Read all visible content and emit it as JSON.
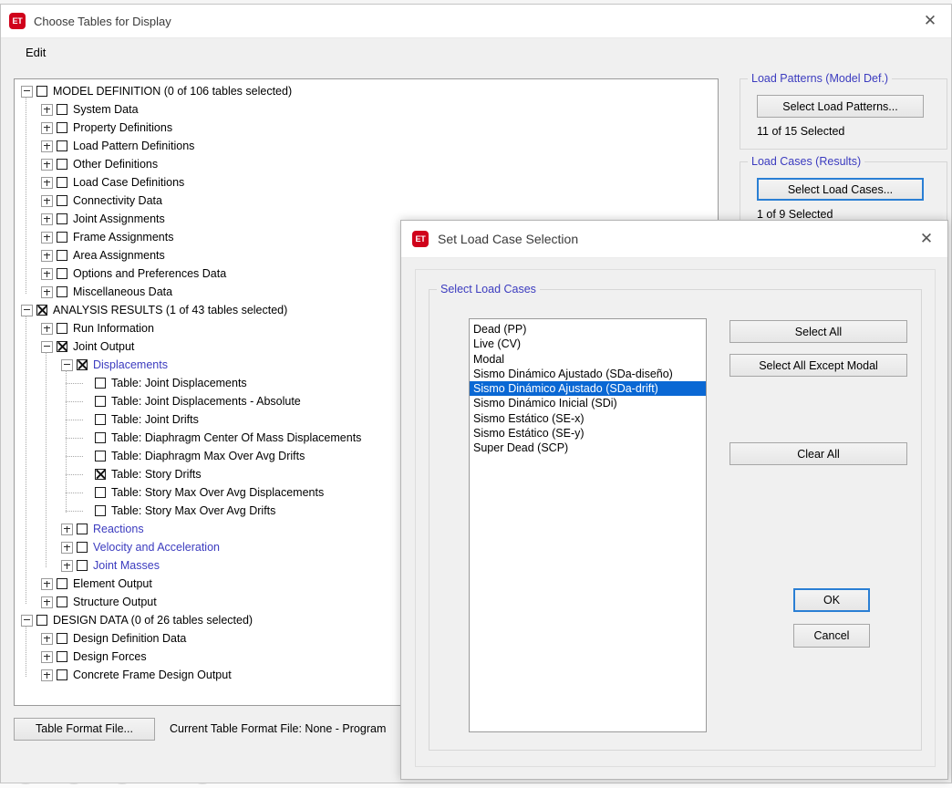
{
  "desktop": {
    "background_circles": [
      "2",
      "0",
      "3",
      "4"
    ]
  },
  "main_window": {
    "icon": "etabs-icon",
    "icon_text": "ET",
    "title": "Choose Tables for Display",
    "close_label": "✕",
    "menu": {
      "edit": "Edit"
    },
    "tree": [
      {
        "level": 0,
        "toggle": "minus",
        "check": "unchecked",
        "label": "MODEL DEFINITION  (0 of 106 tables selected)",
        "color": "black"
      },
      {
        "level": 1,
        "toggle": "plus",
        "check": "unchecked",
        "label": "System Data",
        "color": "black"
      },
      {
        "level": 1,
        "toggle": "plus",
        "check": "unchecked",
        "label": "Property Definitions",
        "color": "black"
      },
      {
        "level": 1,
        "toggle": "plus",
        "check": "unchecked",
        "label": "Load Pattern Definitions",
        "color": "black"
      },
      {
        "level": 1,
        "toggle": "plus",
        "check": "unchecked",
        "label": "Other Definitions",
        "color": "black"
      },
      {
        "level": 1,
        "toggle": "plus",
        "check": "unchecked",
        "label": "Load Case Definitions",
        "color": "black"
      },
      {
        "level": 1,
        "toggle": "plus",
        "check": "unchecked",
        "label": "Connectivity Data",
        "color": "black"
      },
      {
        "level": 1,
        "toggle": "plus",
        "check": "unchecked",
        "label": "Joint Assignments",
        "color": "black"
      },
      {
        "level": 1,
        "toggle": "plus",
        "check": "unchecked",
        "label": "Frame Assignments",
        "color": "black"
      },
      {
        "level": 1,
        "toggle": "plus",
        "check": "unchecked",
        "label": "Area Assignments",
        "color": "black"
      },
      {
        "level": 1,
        "toggle": "plus",
        "check": "unchecked",
        "label": "Options and Preferences Data",
        "color": "black"
      },
      {
        "level": 1,
        "toggle": "plus",
        "check": "unchecked",
        "label": "Miscellaneous Data",
        "color": "black"
      },
      {
        "level": 0,
        "toggle": "minus",
        "check": "checked",
        "label": "ANALYSIS RESULTS  (1 of 43 tables selected)",
        "color": "black"
      },
      {
        "level": 1,
        "toggle": "plus",
        "check": "unchecked",
        "label": "Run Information",
        "color": "black"
      },
      {
        "level": 1,
        "toggle": "minus",
        "check": "checked",
        "label": "Joint Output",
        "color": "black"
      },
      {
        "level": 2,
        "toggle": "minus",
        "check": "checked",
        "label": "Displacements",
        "color": "blue"
      },
      {
        "level": 3,
        "toggle": "none",
        "check": "unchecked",
        "label": "Table:  Joint Displacements",
        "color": "black"
      },
      {
        "level": 3,
        "toggle": "none",
        "check": "unchecked",
        "label": "Table:  Joint Displacements - Absolute",
        "color": "black"
      },
      {
        "level": 3,
        "toggle": "none",
        "check": "unchecked",
        "label": "Table:  Joint Drifts",
        "color": "black"
      },
      {
        "level": 3,
        "toggle": "none",
        "check": "unchecked",
        "label": "Table:  Diaphragm Center Of Mass Displacements",
        "color": "black"
      },
      {
        "level": 3,
        "toggle": "none",
        "check": "unchecked",
        "label": "Table:  Diaphragm Max Over Avg Drifts",
        "color": "black"
      },
      {
        "level": 3,
        "toggle": "none",
        "check": "checked",
        "label": "Table:  Story Drifts",
        "color": "black"
      },
      {
        "level": 3,
        "toggle": "none",
        "check": "unchecked",
        "label": "Table:  Story Max Over Avg Displacements",
        "color": "black"
      },
      {
        "level": 3,
        "toggle": "none",
        "check": "unchecked",
        "label": "Table:  Story Max Over Avg Drifts",
        "color": "black"
      },
      {
        "level": 2,
        "toggle": "plus",
        "check": "unchecked",
        "label": "Reactions",
        "color": "blue"
      },
      {
        "level": 2,
        "toggle": "plus",
        "check": "unchecked",
        "label": "Velocity and Acceleration",
        "color": "blue"
      },
      {
        "level": 2,
        "toggle": "plus",
        "check": "unchecked",
        "label": "Joint Masses",
        "color": "blue"
      },
      {
        "level": 1,
        "toggle": "plus",
        "check": "unchecked",
        "label": "Element Output",
        "color": "black"
      },
      {
        "level": 1,
        "toggle": "plus",
        "check": "unchecked",
        "label": "Structure Output",
        "color": "black"
      },
      {
        "level": 0,
        "toggle": "minus",
        "check": "unchecked",
        "label": "DESIGN DATA  (0 of 26 tables selected)",
        "color": "black"
      },
      {
        "level": 1,
        "toggle": "plus",
        "check": "unchecked",
        "label": "Design Definition Data",
        "color": "black"
      },
      {
        "level": 1,
        "toggle": "plus",
        "check": "unchecked",
        "label": "Design Forces",
        "color": "black"
      },
      {
        "level": 1,
        "toggle": "plus",
        "check": "unchecked",
        "label": "Concrete Frame Design Output",
        "color": "black"
      }
    ],
    "side_panel": {
      "load_patterns": {
        "group_title": "Load Patterns (Model Def.)",
        "button_label": "Select Load Patterns...",
        "status": "11 of 15 Selected"
      },
      "load_cases": {
        "group_title": "Load Cases (Results)",
        "button_label": "Select Load Cases...",
        "status": "1 of 9 Selected"
      }
    },
    "bottom_bar": {
      "button_label": "Table Format File...",
      "status": "Current Table Format File:  None - Program"
    }
  },
  "dialog": {
    "icon_text": "ET",
    "title": "Set Load Case Selection",
    "close_label": "✕",
    "group_title": "Select Load Cases",
    "load_cases": [
      {
        "label": "Dead (PP)",
        "selected": false
      },
      {
        "label": "Live (CV)",
        "selected": false
      },
      {
        "label": "Modal",
        "selected": false
      },
      {
        "label": "Sismo Dinámico Ajustado (SDa-diseño)",
        "selected": false
      },
      {
        "label": "Sismo Dinámico Ajustado (SDa-drift)",
        "selected": true
      },
      {
        "label": "Sismo Dinámico Inicial (SDi)",
        "selected": false
      },
      {
        "label": "Sismo Estático (SE-x)",
        "selected": false
      },
      {
        "label": "Sismo Estático (SE-y)",
        "selected": false
      },
      {
        "label": "Super Dead (SCP)",
        "selected": false
      }
    ],
    "buttons": {
      "select_all": "Select All",
      "select_all_except_modal": "Select All Except Modal",
      "clear_all": "Clear All",
      "ok": "OK",
      "cancel": "Cancel"
    }
  },
  "colors": {
    "selection_blue": "#0a68d4",
    "group_label_blue": "#3b3bbf",
    "focus_blue": "#2a7fd4",
    "brand_red": "#d0021b"
  }
}
